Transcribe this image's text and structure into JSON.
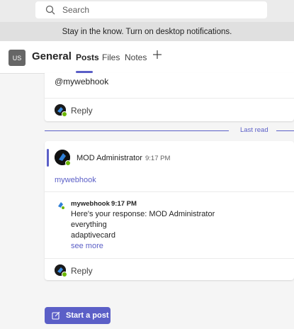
{
  "search": {
    "placeholder": "Search"
  },
  "notification": {
    "text": "Stay in the know. Turn on desktop notifications."
  },
  "team": {
    "initials": "US",
    "channel": "General"
  },
  "tabs": [
    {
      "label": "Posts"
    },
    {
      "label": "Files"
    },
    {
      "label": "Notes"
    }
  ],
  "post1": {
    "mention": "@mywebhook",
    "reply_label": "Reply"
  },
  "last_read": {
    "label": "Last read"
  },
  "post2": {
    "author": "MOD Administrator",
    "time": "9:17 PM",
    "link_text": "mywebhook",
    "bot_reply": {
      "name": "mywebhook",
      "time": "9:17 PM",
      "lines": [
        "Here's your response: MOD Administrator",
        "everything",
        "adaptivecard"
      ],
      "see_more": "see more"
    },
    "reply_label": "Reply"
  },
  "start_post": {
    "label": "Start a post"
  },
  "colors": {
    "accent": "#5b5fc7",
    "presence": "#6bb700"
  }
}
